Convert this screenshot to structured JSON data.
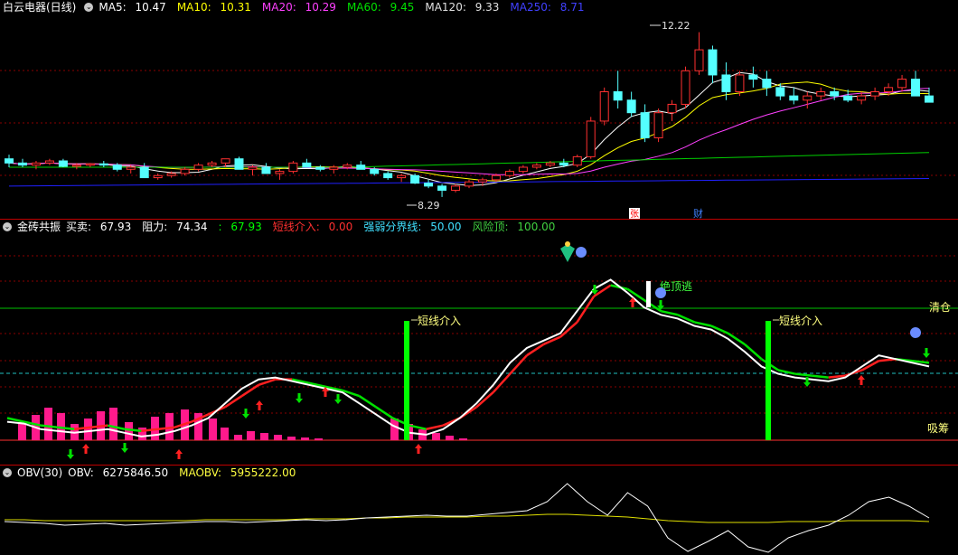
{
  "colors": {
    "up": "#ff3030",
    "down": "#54ffff",
    "ma5": "#ffffff",
    "ma10": "#ffff00",
    "ma20": "#ff40ff",
    "ma60": "#00d000",
    "ma120": "#c0c0c0",
    "ma250": "#2020ff",
    "grid": "#8a0000",
    "obv": "#ffffff",
    "maobv": "#e0e000"
  },
  "price_pane": {
    "title": "白云电器(日线)",
    "indicators": [
      {
        "label": "MA5:",
        "value": "10.47"
      },
      {
        "label": "MA10:",
        "value": "10.31"
      },
      {
        "label": "MA20:",
        "value": "10.29"
      },
      {
        "label": "MA60:",
        "value": "9.45"
      },
      {
        "label": "MA120:",
        "value": "9.33"
      },
      {
        "label": "MA250:",
        "value": "8.71"
      }
    ],
    "high_label": "12.22",
    "low_label": "8.29",
    "event_markers": [
      "张",
      "财"
    ]
  },
  "signal_pane": {
    "title": "金砖共振",
    "items": [
      {
        "label": "买卖:",
        "value": "67.93"
      },
      {
        "label": "阻力:",
        "value": "74.34"
      },
      {
        "label": ":",
        "value": "67.93"
      },
      {
        "label": "短线介入:",
        "value": "0.00"
      },
      {
        "label": "强弱分界线:",
        "value": "50.00"
      },
      {
        "label": "风险顶:",
        "value": "100.00"
      }
    ],
    "annotations": {
      "entry": "短线介入",
      "escape_top": "绝顶逃",
      "clear": "清仓",
      "accumulate": "吸筹"
    }
  },
  "obv_pane": {
    "title": "OBV(30)",
    "obv_label": "OBV:",
    "obv_value": "6275846.50",
    "maobv_label": "MAOBV:",
    "maobv_value": "5955222.00"
  },
  "chart_data": [
    {
      "type": "candlestick",
      "title": "白云电器(日线)",
      "ohlc": [
        [
          9.2,
          9.3,
          9.0,
          9.1
        ],
        [
          9.1,
          9.2,
          9.0,
          9.05
        ],
        [
          9.05,
          9.15,
          8.95,
          9.1
        ],
        [
          9.1,
          9.2,
          9.05,
          9.15
        ],
        [
          9.15,
          9.2,
          9.0,
          9.02
        ],
        [
          9.02,
          9.1,
          8.95,
          9.05
        ],
        [
          9.05,
          9.1,
          9.0,
          9.08
        ],
        [
          9.08,
          9.15,
          9.0,
          9.05
        ],
        [
          9.05,
          9.1,
          8.9,
          8.95
        ],
        [
          8.95,
          9.05,
          8.85,
          9.0
        ],
        [
          9.0,
          9.1,
          8.9,
          8.75
        ],
        [
          8.75,
          8.85,
          8.7,
          8.8
        ],
        [
          8.8,
          8.9,
          8.75,
          8.85
        ],
        [
          8.85,
          9.0,
          8.8,
          8.95
        ],
        [
          8.95,
          9.1,
          8.9,
          9.05
        ],
        [
          9.05,
          9.15,
          9.0,
          9.1
        ],
        [
          9.1,
          9.2,
          9.0,
          9.2
        ],
        [
          9.2,
          9.25,
          9.0,
          8.95
        ],
        [
          8.95,
          9.05,
          8.8,
          9.0
        ],
        [
          9.0,
          9.1,
          8.9,
          8.85
        ],
        [
          8.85,
          8.95,
          8.7,
          8.9
        ],
        [
          8.9,
          9.15,
          8.85,
          9.1
        ],
        [
          9.1,
          9.2,
          9.0,
          9.0
        ],
        [
          9.0,
          9.05,
          8.9,
          8.95
        ],
        [
          8.95,
          9.05,
          8.85,
          9.0
        ],
        [
          9.0,
          9.1,
          8.95,
          9.05
        ],
        [
          9.05,
          9.15,
          9.0,
          8.95
        ],
        [
          8.95,
          9.0,
          8.8,
          8.85
        ],
        [
          8.85,
          8.9,
          8.7,
          8.75
        ],
        [
          8.75,
          8.85,
          8.65,
          8.8
        ],
        [
          8.8,
          8.85,
          8.6,
          8.62
        ],
        [
          8.62,
          8.7,
          8.5,
          8.55
        ],
        [
          8.55,
          8.6,
          8.29,
          8.45
        ],
        [
          8.45,
          8.6,
          8.4,
          8.55
        ],
        [
          8.55,
          8.7,
          8.5,
          8.65
        ],
        [
          8.65,
          8.75,
          8.55,
          8.7
        ],
        [
          8.7,
          8.85,
          8.65,
          8.8
        ],
        [
          8.8,
          8.95,
          8.75,
          8.9
        ],
        [
          8.9,
          9.05,
          8.85,
          9.0
        ],
        [
          9.0,
          9.1,
          8.95,
          9.05
        ],
        [
          9.05,
          9.15,
          9.0,
          9.1
        ],
        [
          9.1,
          9.2,
          9.0,
          9.05
        ],
        [
          9.05,
          9.3,
          9.0,
          9.25
        ],
        [
          9.25,
          10.2,
          9.2,
          10.1
        ],
        [
          10.1,
          10.9,
          10.0,
          10.8
        ],
        [
          10.8,
          11.3,
          10.4,
          10.6
        ],
        [
          10.6,
          10.8,
          10.2,
          10.3
        ],
        [
          10.3,
          10.5,
          9.6,
          9.7
        ],
        [
          9.7,
          10.4,
          9.6,
          10.3
        ],
        [
          10.3,
          10.6,
          10.1,
          10.5
        ],
        [
          10.5,
          11.4,
          10.4,
          11.3
        ],
        [
          11.3,
          12.22,
          11.2,
          11.8
        ],
        [
          11.8,
          11.9,
          11.0,
          11.2
        ],
        [
          11.2,
          11.5,
          10.6,
          10.8
        ],
        [
          10.8,
          11.3,
          10.7,
          11.2
        ],
        [
          11.2,
          11.4,
          10.9,
          11.1
        ],
        [
          11.1,
          11.3,
          10.7,
          10.9
        ],
        [
          10.9,
          11.0,
          10.6,
          10.7
        ],
        [
          10.7,
          10.9,
          10.5,
          10.6
        ],
        [
          10.6,
          10.8,
          10.4,
          10.7
        ],
        [
          10.7,
          10.9,
          10.6,
          10.8
        ],
        [
          10.8,
          10.9,
          10.6,
          10.7
        ],
        [
          10.7,
          10.85,
          10.55,
          10.6
        ],
        [
          10.6,
          10.8,
          10.5,
          10.7
        ],
        [
          10.7,
          10.9,
          10.6,
          10.8
        ],
        [
          10.8,
          11.0,
          10.7,
          10.9
        ],
        [
          10.9,
          11.2,
          10.8,
          11.1
        ],
        [
          11.1,
          11.3,
          10.9,
          10.7
        ],
        [
          10.7,
          10.9,
          10.6,
          10.55
        ]
      ],
      "ma_series": [
        "MA5",
        "MA10",
        "MA20",
        "MA60",
        "MA120",
        "MA250"
      ],
      "high": 12.22,
      "low": 8.29
    },
    {
      "type": "line",
      "title": "金砖共振",
      "series": [
        {
          "name": "买卖",
          "values": [
            10,
            9,
            6,
            5,
            4,
            5,
            6,
            4,
            2,
            3,
            5,
            8,
            12,
            20,
            28,
            33,
            34,
            32,
            30,
            28,
            26,
            20,
            14,
            8,
            4,
            3,
            6,
            12,
            20,
            30,
            42,
            50,
            54,
            58,
            70,
            82,
            87,
            80,
            72,
            68,
            66,
            62,
            60,
            55,
            48,
            40,
            36,
            34,
            33,
            32,
            34,
            40,
            46,
            44,
            42,
            40
          ]
        },
        {
          "name": "阻力",
          "values": [
            12,
            10,
            8,
            7,
            6,
            7,
            8,
            6,
            5,
            6,
            7,
            10,
            14,
            18,
            24,
            30,
            33,
            33,
            31,
            29,
            27,
            24,
            18,
            12,
            8,
            6,
            8,
            12,
            18,
            26,
            36,
            46,
            52,
            56,
            64,
            78,
            84,
            82,
            76,
            70,
            68,
            64,
            62,
            58,
            52,
            44,
            38,
            36,
            35,
            34,
            35,
            38,
            43,
            44,
            43,
            42
          ]
        }
      ],
      "reference_lines": [
        {
          "name": "强弱分界线",
          "value": 50
        },
        {
          "name": "风险顶",
          "value": 100
        }
      ]
    },
    {
      "type": "line",
      "title": "OBV(30)",
      "series": [
        {
          "name": "OBV",
          "values": [
            6275846.5
          ]
        },
        {
          "name": "MAOBV",
          "values": [
            5955222.0
          ]
        }
      ]
    }
  ]
}
